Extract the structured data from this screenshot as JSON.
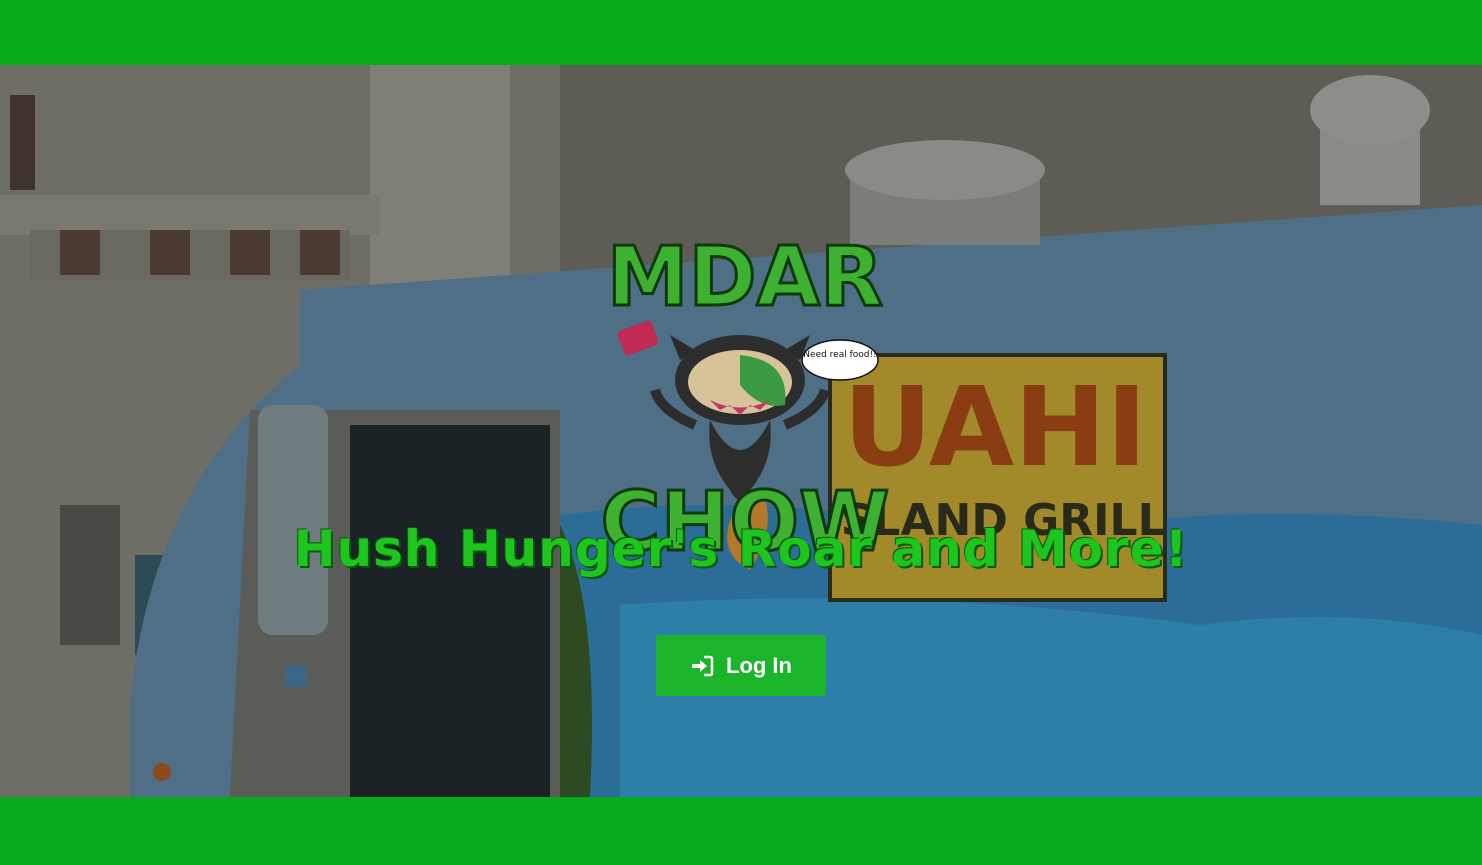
{
  "brand": {
    "logo_line1": "MDAR",
    "logo_line2": "CHOW",
    "speech_bubble": "Need real food!!",
    "logo_alt": "MDAR CHOW octocat logo"
  },
  "hero": {
    "tagline": "Hush Hunger's Roar and More!",
    "truck_sign_line1": "UAHI",
    "truck_sign_line2": "ISLAND GRILL"
  },
  "actions": {
    "login_label": "Log In",
    "login_icon": "sign-in-icon"
  },
  "colors": {
    "accent_green": "#08aa1c",
    "tagline_green": "#1ec51e",
    "button_green": "#1ab52a"
  }
}
